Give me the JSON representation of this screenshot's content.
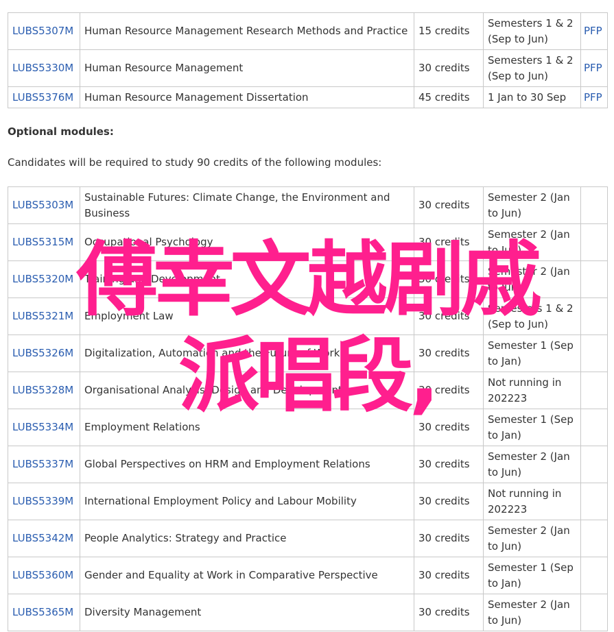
{
  "required_modules": [
    {
      "code": "LUBS5307M",
      "title": "Human Resource Management Research Methods and Practice",
      "credits": "15 credits",
      "semester": "Semesters 1 & 2 (Sep to Jun)",
      "pfp": "PFP"
    },
    {
      "code": "LUBS5330M",
      "title": "Human Resource Management",
      "credits": "30 credits",
      "semester": "Semesters 1 & 2 (Sep to Jun)",
      "pfp": "PFP"
    },
    {
      "code": "LUBS5376M",
      "title": "Human Resource Management Dissertation",
      "credits": "45 credits",
      "semester": "1 Jan to 30 Sep",
      "pfp": "PFP"
    }
  ],
  "optional": {
    "heading": "Optional modules:",
    "description": "Candidates will be required to study 90 credits of the following modules:"
  },
  "optional_modules": [
    {
      "code": "LUBS5303M",
      "title": "Sustainable Futures: Climate Change, the Environment and Business",
      "credits": "30 credits",
      "semester": "Semester 2 (Jan to Jun)"
    },
    {
      "code": "LUBS5315M",
      "title": "Occupational Psychology",
      "credits": "30 credits",
      "semester": "Semester 2 (Jan to Jun)"
    },
    {
      "code": "LUBS5320M",
      "title": "Training and Development",
      "credits": "30 credits",
      "semester": "Semester 2 (Jan to Jun)"
    },
    {
      "code": "LUBS5321M",
      "title": "Employment Law",
      "credits": "30 credits",
      "semester": "Semesters 1 & 2 (Sep to Jun)"
    },
    {
      "code": "LUBS5326M",
      "title": "Digitalization, Automation and the Future of Work",
      "credits": "30 credits",
      "semester": "Semester 1 (Sep to Jan)"
    },
    {
      "code": "LUBS5328M",
      "title": "Organisational Analysis, Design and Development",
      "credits": "30 credits",
      "semester": "Not running in 202223"
    },
    {
      "code": "LUBS5334M",
      "title": "Employment Relations",
      "credits": "30 credits",
      "semester": "Semester 1 (Sep to Jan)"
    },
    {
      "code": "LUBS5337M",
      "title": "Global Perspectives on HRM and Employment Relations",
      "credits": "30 credits",
      "semester": "Semester 2 (Jan to Jun)"
    },
    {
      "code": "LUBS5339M",
      "title": "International Employment Policy and Labour Mobility",
      "credits": "30 credits",
      "semester": "Not running in 202223"
    },
    {
      "code": "LUBS5342M",
      "title": "People Analytics: Strategy and Practice",
      "credits": "30 credits",
      "semester": "Semester 2 (Jan to Jun)"
    },
    {
      "code": "LUBS5360M",
      "title": "Gender and Equality at Work in Comparative Perspective",
      "credits": "30 credits",
      "semester": "Semester 1 (Sep to Jan)"
    },
    {
      "code": "LUBS5365M",
      "title": "Diversity Management",
      "credits": "30 credits",
      "semester": "Semester 2 (Jan to Jun)"
    }
  ],
  "overlay": {
    "line1": "傅幸文越剧戚",
    "line2": "派唱段,",
    "color": "#ff1f8e"
  },
  "colors": {
    "link": "#2a5db0",
    "text": "#333333",
    "border": "#c8c8c8"
  }
}
